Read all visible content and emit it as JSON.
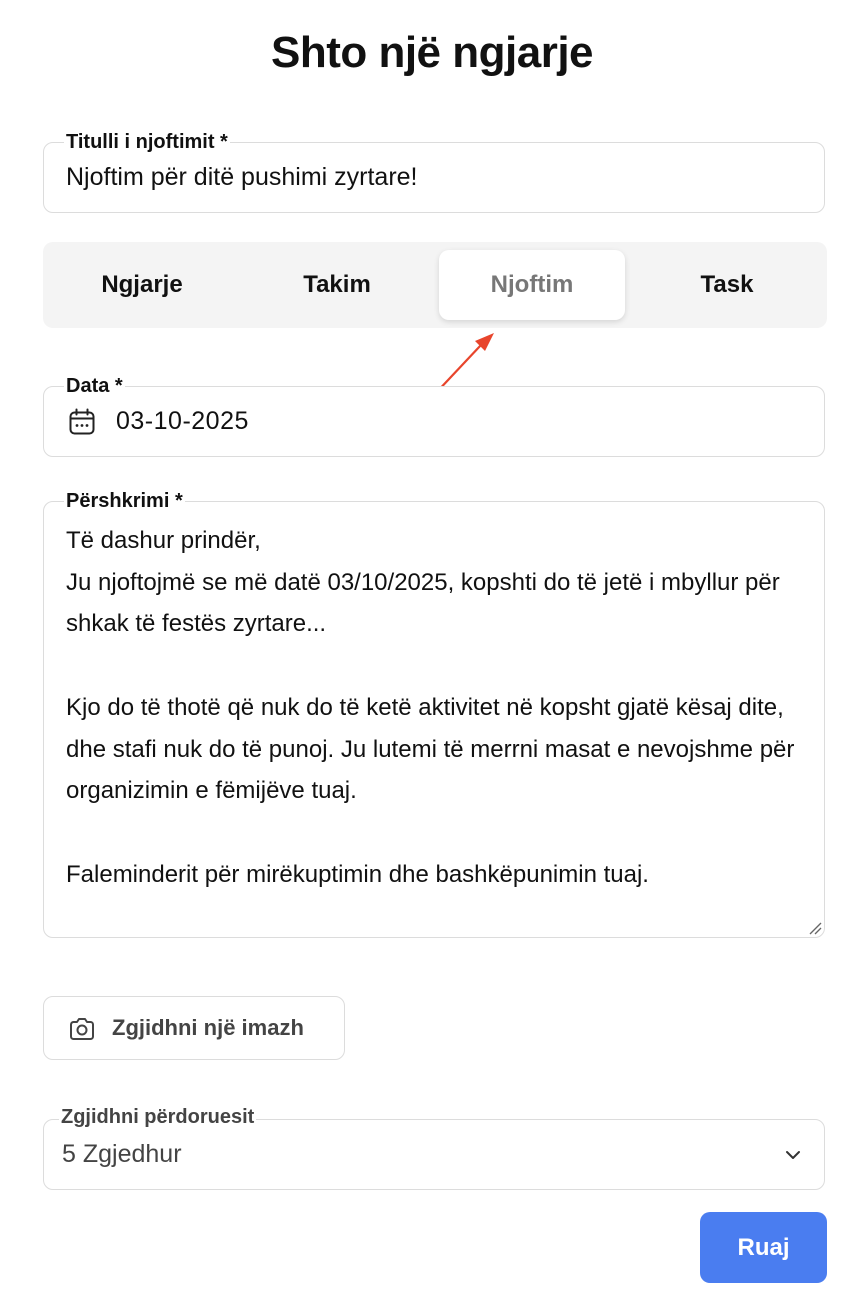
{
  "page": {
    "title": "Shto një ngjarje"
  },
  "title_field": {
    "label": "Titulli i njoftimit *",
    "value": "Njoftim për ditë pushimi zyrtare!"
  },
  "tabs": [
    {
      "label": "Ngjarje",
      "active": false
    },
    {
      "label": "Takim",
      "active": false
    },
    {
      "label": "Njoftim",
      "active": true
    },
    {
      "label": "Task",
      "active": false
    }
  ],
  "date_field": {
    "label": "Data *",
    "value": "03-10-2025",
    "icon": "calendar-icon"
  },
  "description_field": {
    "label": "Përshkrimi *",
    "value": "Të dashur prindër,\nJu njoftojmë se më datë 03/10/2025, kopshti do të jetë i mbyllur për shkak të festës zyrtare...\n\nKjo do të thotë që nuk do të ketë aktivitet në kopsht gjatë kësaj dite, dhe stafi nuk do të punoj. Ju lutemi të merrni masat e nevojshme për organizimin e fëmijëve tuaj.\n\nFaleminderit për mirëkuptimin dhe bashkëpunimin tuaj."
  },
  "image_button": {
    "label": "Zgjidhni një imazh",
    "icon": "camera-icon"
  },
  "users_select": {
    "label": "Zgjidhni përdoruesit",
    "value": "5 Zgjedhur",
    "icon": "chevron-down-icon"
  },
  "save_button": {
    "label": "Ruaj",
    "color": "#4a7df0"
  },
  "colors": {
    "accent": "#4a7df0",
    "annotation_arrow": "#e8452c"
  }
}
